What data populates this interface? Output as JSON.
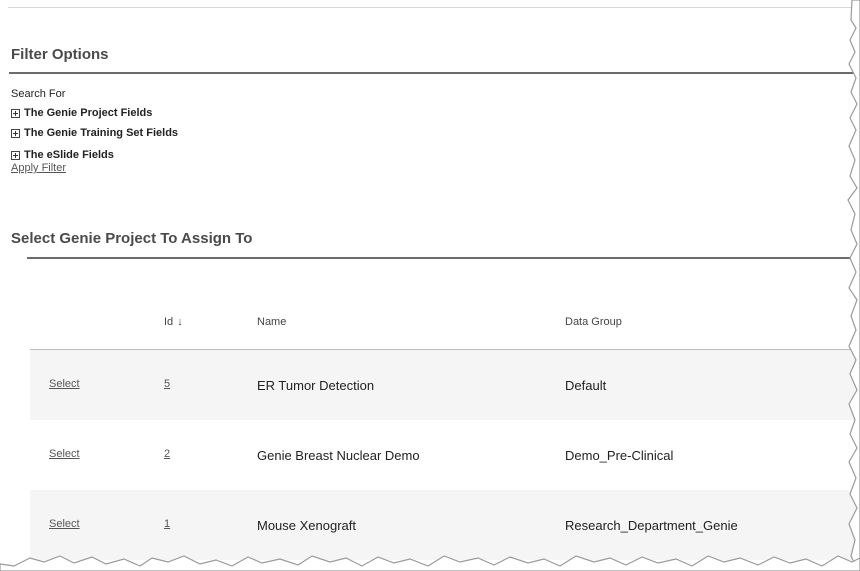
{
  "filter": {
    "title": "Filter Options",
    "search_for": "Search For",
    "expanders": [
      {
        "label": "The Genie Project Fields"
      },
      {
        "label": "The Genie Training Set Fields"
      },
      {
        "label": "The eSlide Fields"
      }
    ],
    "apply_label": "Apply Filter"
  },
  "assign": {
    "title": "Select Genie Project To Assign To",
    "columns": {
      "id": "Id",
      "id_sort_icon": "↓",
      "name": "Name",
      "group": "Data Group"
    },
    "rows": [
      {
        "action": "Select",
        "id": "5",
        "name": "ER Tumor Detection",
        "group": "Default"
      },
      {
        "action": "Select",
        "id": "2",
        "name": "Genie Breast Nuclear Demo",
        "group": "Demo_Pre-Clinical"
      },
      {
        "action": "Select",
        "id": "1",
        "name": "Mouse Xenograft",
        "group": "Research_Department_Genie"
      }
    ]
  }
}
